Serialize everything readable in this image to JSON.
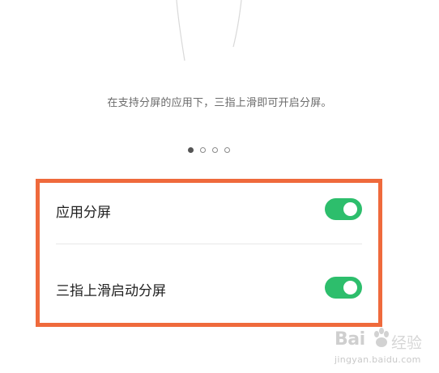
{
  "gesture": {
    "description": "在支持分屏的应用下，三指上滑即可开启分屏。"
  },
  "pager": {
    "page_count": 4,
    "active_page": 1
  },
  "settings": {
    "items": [
      {
        "label": "应用分屏",
        "enabled": true
      },
      {
        "label": "三指上滑启动分屏",
        "enabled": true
      }
    ]
  },
  "watermark": {
    "brand_latin": "Bai",
    "brand_cn": "经验",
    "domain": "jingyan.baidu.com"
  },
  "colors": {
    "toggle_on": "#2dbe6c",
    "highlight_border": "#ef6a3c"
  }
}
